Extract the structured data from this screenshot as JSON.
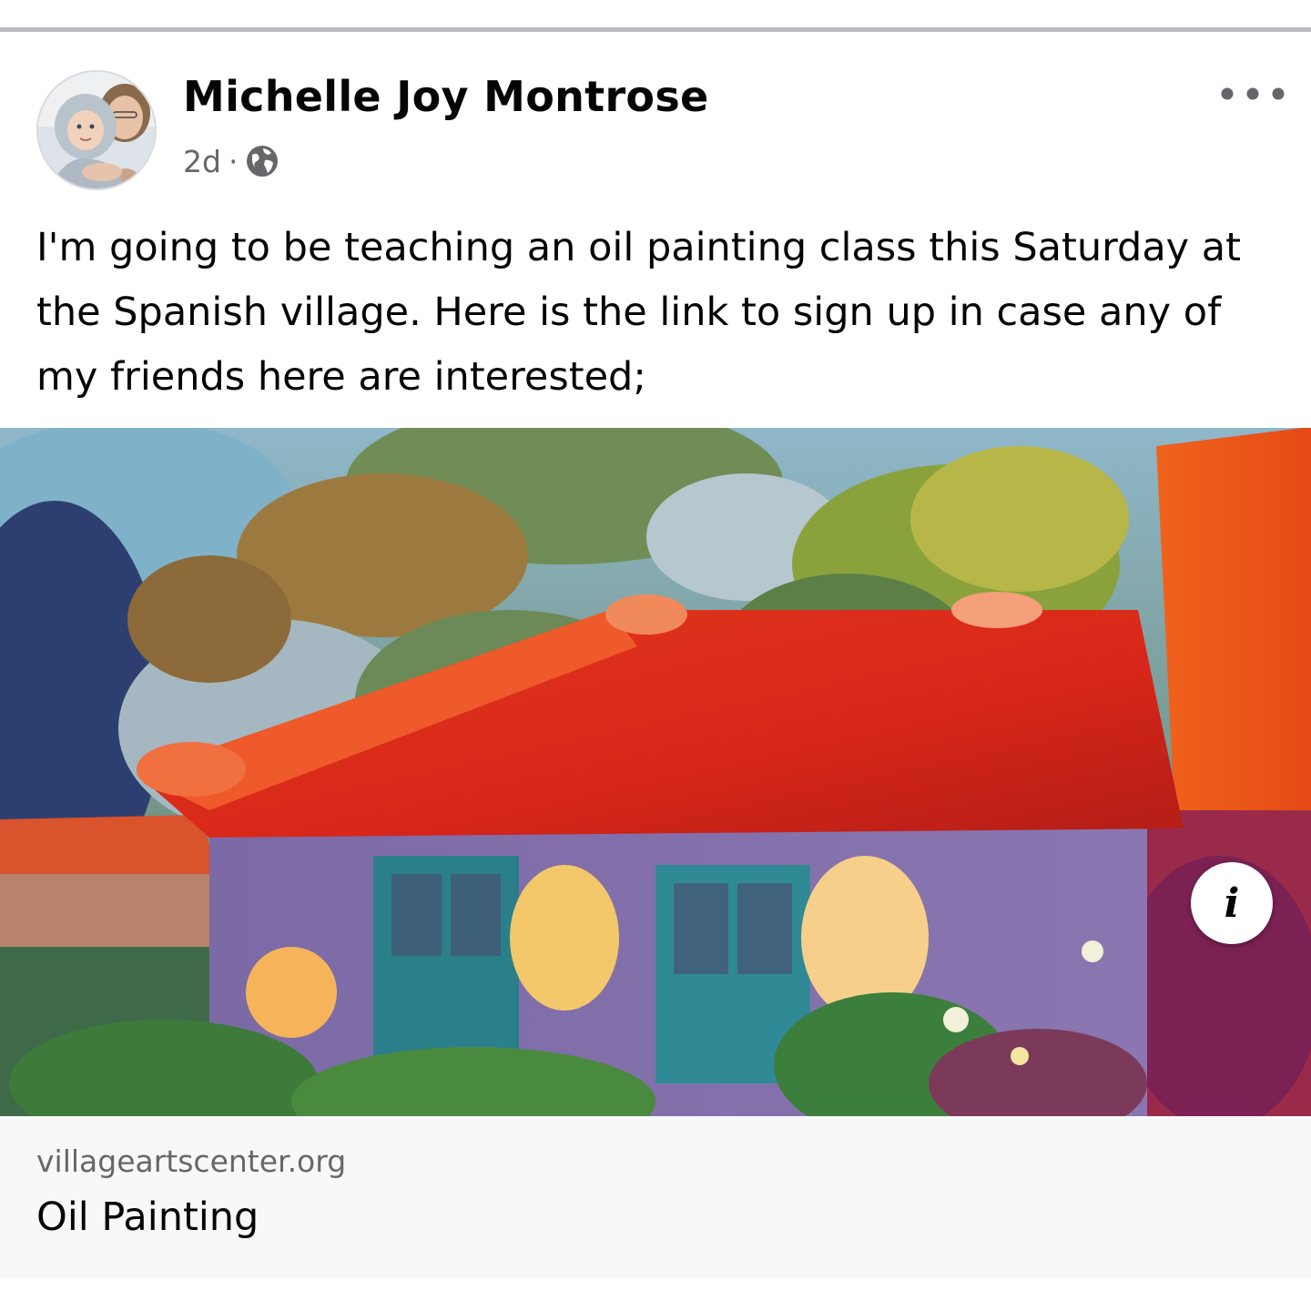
{
  "post": {
    "author_name": "Michelle Joy Montrose",
    "timestamp": "2d",
    "separator": "·",
    "privacy_icon": "globe-icon",
    "more_icon": "more-horizontal-icon",
    "text": "I'm going to be teaching an oil painting class this Saturday at the Spanish village. Here is the link to sign up in case any of my friends here are interested;"
  },
  "link_preview": {
    "image_description": "oil-painting-spanish-village-house",
    "info_icon": "info-icon",
    "info_glyph": "i",
    "domain": "villageartscenter.org",
    "title": "Oil Painting"
  },
  "colors": {
    "text_primary": "#050505",
    "text_secondary": "#65676b",
    "card_footer_bg": "#f7f8fa",
    "divider": "#b9babe"
  }
}
